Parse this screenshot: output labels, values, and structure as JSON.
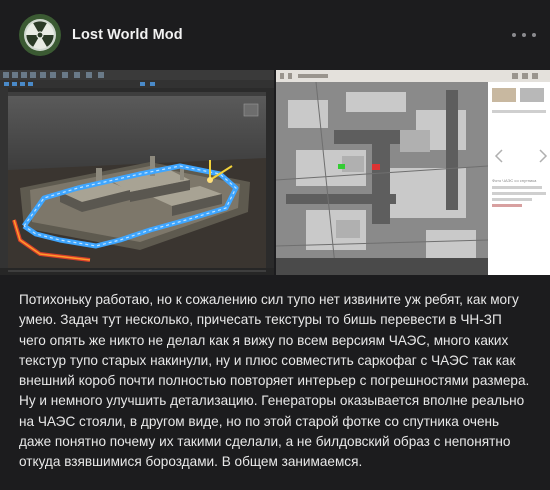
{
  "channel": {
    "name": "Lost World Mod",
    "avatar_icon": "radiation-icon"
  },
  "post": {
    "text": "Потихоньку работаю, но к сожалению сил тупо нет извините уж ребят, как могу умею. Задач тут несколько, причесать текстуры то бишь перевести в ЧН-ЗП чего опять же никто не делал как я вижу по всем версиям ЧАЭС, много каких текстур тупо старых накинули, ну и плюс совместить саркофаг с ЧАЭС так как внешний короб почти полностью повторяет интерьер с погрешностями размера. Ну и немного улучшить детализацию. Генераторы оказывается вполне реально на ЧАЭС стояли, в другом виде, но по этой старой фотке со спутника очень даже понятно почему их такими сделали, а не билдовский образ с непонятно откуда взявшимися бороздами. В общем занимаемся."
  },
  "photo_right": {
    "caption": "Фото ЧАЭС со спутника"
  },
  "colors": {
    "background": "#1c1c1e",
    "text": "#e8e8e8",
    "muted": "#8a8a8e",
    "avatar_bg": "#2f4a2a",
    "accent_blue": "#4aa0e0"
  }
}
